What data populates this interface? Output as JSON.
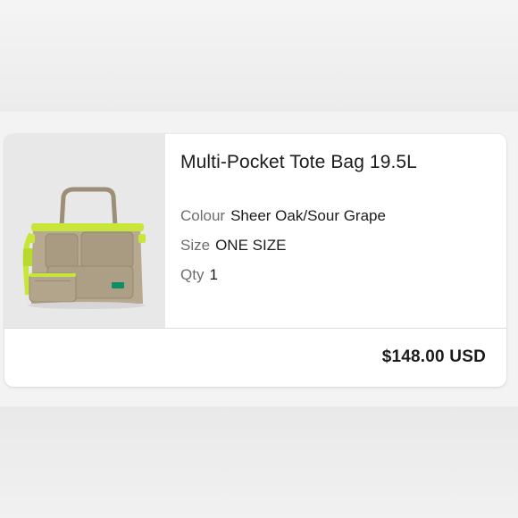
{
  "item": {
    "title": "Multi-Pocket Tote Bag 19.5L",
    "image_icon": "tote-bag-photo",
    "attributes": {
      "colour_label": "Colour",
      "colour_value": "Sheer Oak/Sour Grape",
      "size_label": "Size",
      "size_value": "ONE SIZE",
      "qty_label": "Qty",
      "qty_value": "1"
    },
    "price": "$148.00 USD"
  },
  "colors": {
    "bag_body": "#b7a98f",
    "bag_accent": "#c8e63a",
    "card_bg": "#ffffff",
    "image_bg": "#e8e8e8"
  }
}
